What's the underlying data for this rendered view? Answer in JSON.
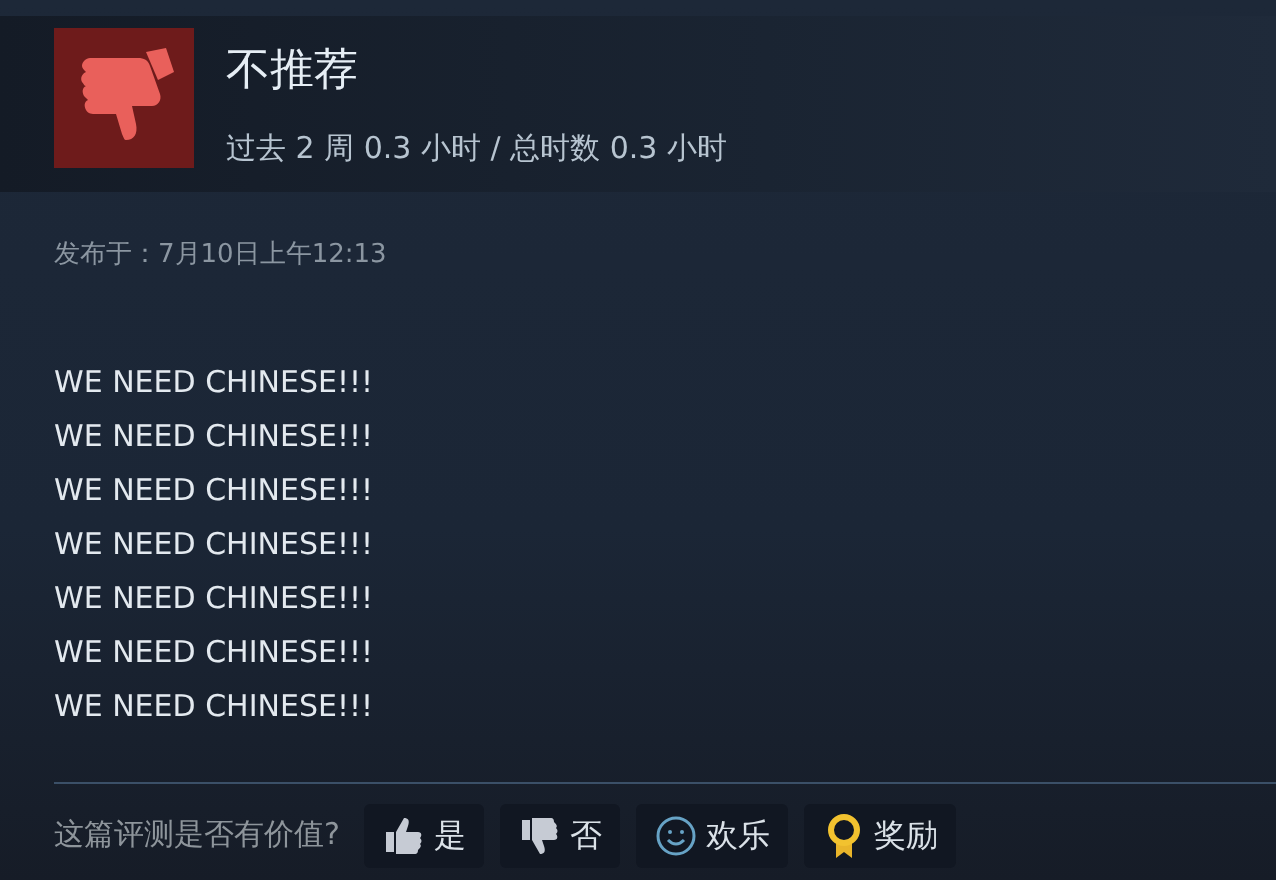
{
  "review": {
    "verdict": "不推荐",
    "playtime": "过去 2 周 0.3 小时 / 总时数 0.3 小时",
    "posted": "发布于：7月10日上午12:13",
    "body": [
      "WE NEED CHINESE!!!",
      "WE NEED CHINESE!!!",
      "WE NEED CHINESE!!!",
      "WE NEED CHINESE!!!",
      "WE NEED CHINESE!!!",
      "WE NEED CHINESE!!!",
      "WE NEED CHINESE!!!"
    ]
  },
  "feedback": {
    "prompt": "这篇评测是否有价值?",
    "buttons": [
      {
        "label": "是",
        "kind": "thumbs-up"
      },
      {
        "label": "否",
        "kind": "thumbs-down"
      },
      {
        "label": "欢乐",
        "kind": "smile"
      },
      {
        "label": "奖励",
        "kind": "award"
      }
    ]
  }
}
